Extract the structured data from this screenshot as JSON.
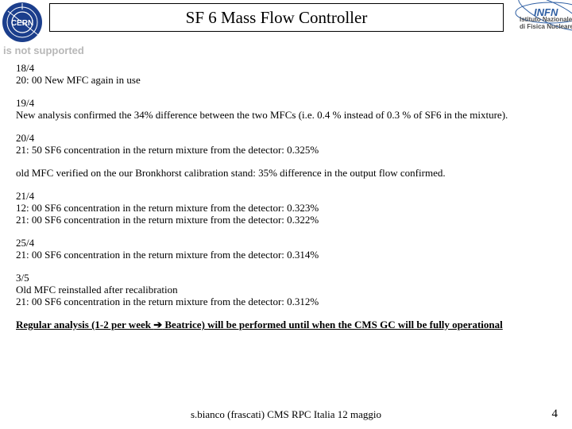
{
  "header": {
    "title": "SF 6 Mass Flow Controller",
    "nosupport": "is not supported",
    "infn_line1": "Istituto Nazionale",
    "infn_line2": "di Fisica Nucleare"
  },
  "entries": {
    "e1_date": "18/4",
    "e1_line": "20: 00 New MFC again in use",
    "e2_date": "19/4",
    "e2_line": "New analysis confirmed the 34% difference between the two MFCs (i.e. 0.4 % instead of 0.3 % of SF6 in the mixture).",
    "e3_date": "20/4",
    "e3_line": "21: 50 SF6 concentration in the return mixture from the detector:  0.325%",
    "e4_line": "old MFC verified on the our Bronkhorst calibration stand: 35% difference in the output flow confirmed.",
    "e5_date": "21/4",
    "e5_line1": "12: 00 SF6 concentration in the return mixture from the detector:  0.323%",
    "e5_line2": "21: 00 SF6 concentration in the return mixture from the detector:  0.322%",
    "e6_date": "25/4",
    "e6_line": "21: 00 SF6 concentration in the return mixture from the detector:  0.314%",
    "e7_date": "3/5",
    "e7_line1": "Old MFC reinstalled after recalibration",
    "e7_line2": "21: 00 SF6 concentration in the return mixture from the detector:  0.312%"
  },
  "summary": {
    "part1": "Regular analysis (1-2 per week ",
    "arrow": "➔",
    "part2": " Beatrice) will be performed until when the CMS GC will be fully operational"
  },
  "footer": {
    "text": "s.bianco (frascati) CMS RPC Italia 12 maggio",
    "page": "4"
  }
}
